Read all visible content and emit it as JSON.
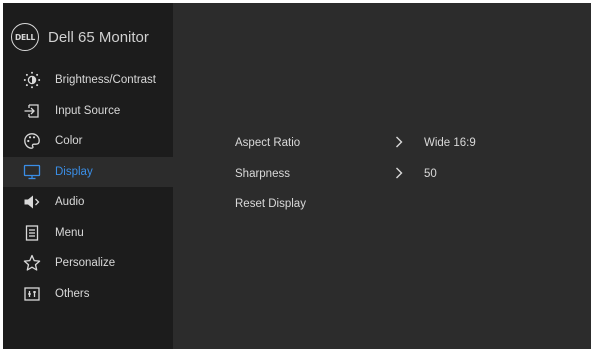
{
  "brand": {
    "logo_text": "DELL",
    "title": "Dell 65 Monitor"
  },
  "sidebar": {
    "items": [
      {
        "label": "Brightness/Contrast",
        "icon": "brightness-icon",
        "active": false
      },
      {
        "label": "Input Source",
        "icon": "input-source-icon",
        "active": false
      },
      {
        "label": "Color",
        "icon": "palette-icon",
        "active": false
      },
      {
        "label": "Display",
        "icon": "monitor-icon",
        "active": true
      },
      {
        "label": "Audio",
        "icon": "speaker-icon",
        "active": false
      },
      {
        "label": "Menu",
        "icon": "menu-icon",
        "active": false
      },
      {
        "label": "Personalize",
        "icon": "star-icon",
        "active": false
      },
      {
        "label": "Others",
        "icon": "others-icon",
        "active": false
      }
    ]
  },
  "display_settings": {
    "rows": [
      {
        "label": "Aspect Ratio",
        "value": "Wide 16:9",
        "has_submenu": true
      },
      {
        "label": "Sharpness",
        "value": "50",
        "has_submenu": true
      },
      {
        "label": "Reset Display",
        "value": "",
        "has_submenu": false
      }
    ]
  },
  "colors": {
    "sidebar_bg": "#1c1c1c",
    "panel_bg": "#2c2c2c",
    "text": "#d9d9d9",
    "active_accent": "#3a8ee6"
  }
}
